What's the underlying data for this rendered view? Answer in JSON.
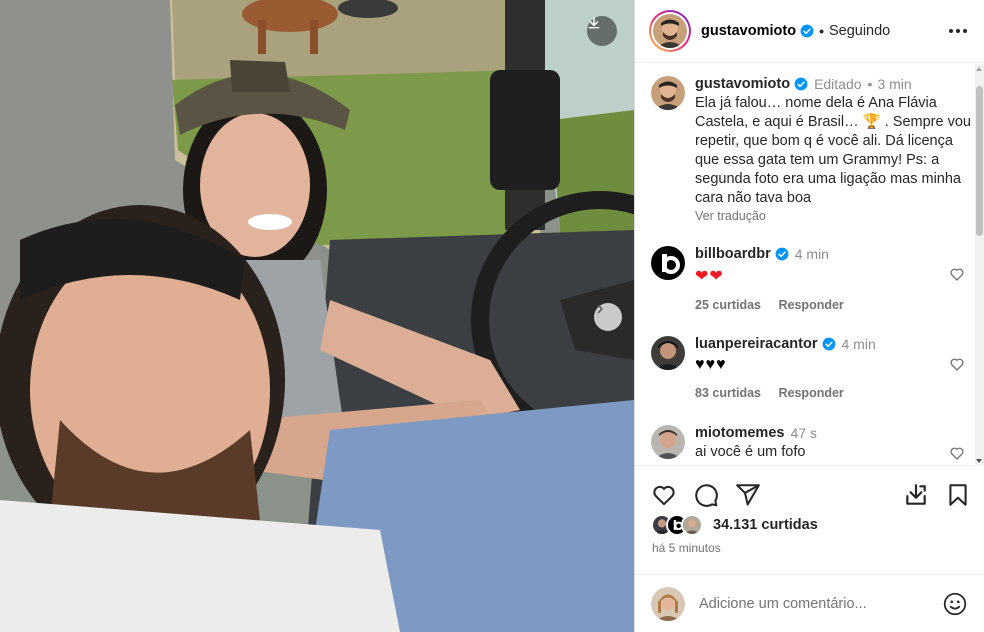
{
  "post": {
    "username": "gustavomioto",
    "follow_status": "Seguindo",
    "more_icon": "more-horizontal-icon"
  },
  "caption": {
    "username": "gustavomioto",
    "edited": "Editado",
    "time": "3 min",
    "text": "Ela já falou… nome dela é Ana Flávia Castela, e aqui é Brasil… 🏆 . Sempre vou repetir, que bom q é você ali. Dá licença que essa gata tem um Grammy! Ps: a segunda foto era uma ligação mas minha cara não tava boa",
    "translate_label": "Ver tradução"
  },
  "comments": [
    {
      "username": "billboardbr",
      "verified": true,
      "time": "4 min",
      "text": "❤❤",
      "likes": "25 curtidas",
      "reply": "Responder"
    },
    {
      "username": "luanpereiracantor",
      "verified": true,
      "time": "4 min",
      "text": "♥♥♥",
      "likes": "83 curtidas",
      "reply": "Responder"
    },
    {
      "username": "miotomemes",
      "verified": false,
      "time": "47 s",
      "text": "ai você é um fofo"
    }
  ],
  "actions": {
    "like_icon": "heart-icon",
    "comment_icon": "comment-icon",
    "share_icon": "share-icon",
    "download_icon": "download-icon",
    "save_icon": "bookmark-icon"
  },
  "likes_count": "34.131 curtidas",
  "posted_time": "há 5 minutos",
  "comment_input": {
    "placeholder": "Adicione um comentário..."
  },
  "colors": {
    "verified": "#0095f6",
    "red_heart": "#ed1c24",
    "text": "#262626",
    "muted": "#737373"
  }
}
